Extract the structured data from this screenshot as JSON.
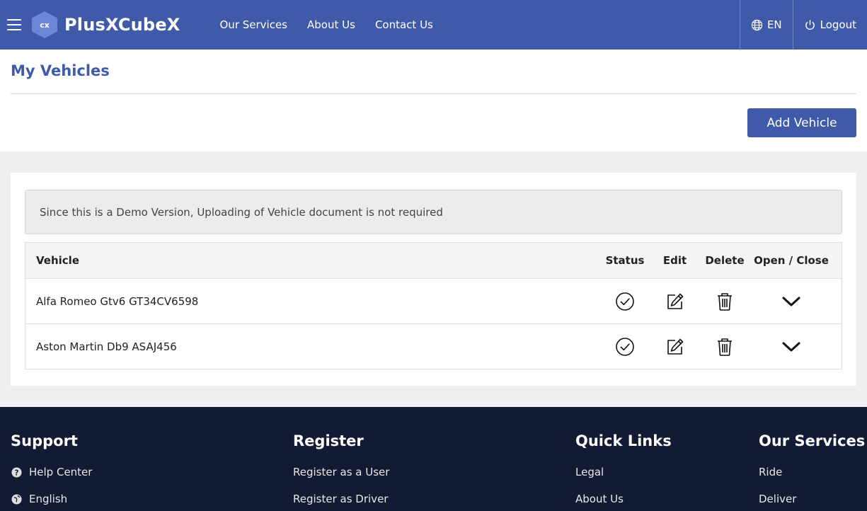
{
  "header": {
    "logo_text": "cx",
    "brand": "PlusXCubeX",
    "nav": [
      "Our Services",
      "About Us",
      "Contact Us"
    ],
    "language": "EN",
    "logout": "Logout",
    "colors": {
      "primary": "#3f5aa8"
    }
  },
  "page": {
    "title": "My Vehicles",
    "add_button": "Add Vehicle"
  },
  "notice": "Since this is a Demo Version, Uploading of Vehicle document is not required",
  "table": {
    "headers": {
      "vehicle": "Vehicle",
      "status": "Status",
      "edit": "Edit",
      "delete": "Delete",
      "open_close": "Open / Close"
    },
    "rows": [
      {
        "vehicle": "Alfa Romeo Gtv6 GT34CV6598",
        "status_icon": "check-circle-icon"
      },
      {
        "vehicle": "Aston Martin Db9 ASAJ456",
        "status_icon": "check-circle-icon"
      }
    ]
  },
  "footer": {
    "support": {
      "title": "Support",
      "items": [
        "Help Center",
        "English"
      ]
    },
    "register": {
      "title": "Register",
      "items": [
        "Register as a User",
        "Register as Driver"
      ]
    },
    "quick_links": {
      "title": "Quick Links",
      "items": [
        "Legal",
        "About Us"
      ]
    },
    "services": {
      "title": "Our Services",
      "items": [
        "Ride",
        "Deliver"
      ]
    }
  }
}
